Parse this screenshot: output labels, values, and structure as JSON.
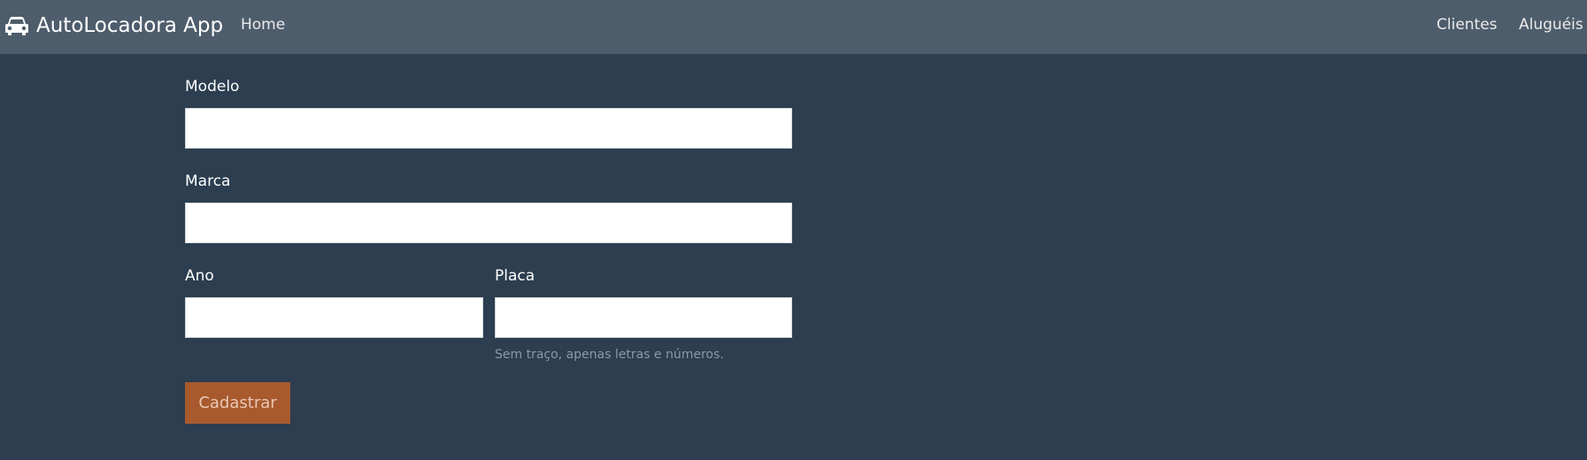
{
  "navbar": {
    "brand": "AutoLocadora App",
    "brand_icon": "car-icon",
    "links": {
      "home": "Home",
      "clientes": "Clientes",
      "alugueis": "Aluguéis"
    }
  },
  "form": {
    "modelo": {
      "label": "Modelo",
      "value": ""
    },
    "marca": {
      "label": "Marca",
      "value": ""
    },
    "ano": {
      "label": "Ano",
      "value": ""
    },
    "placa": {
      "label": "Placa",
      "value": "",
      "help": "Sem traço, apenas letras e números."
    },
    "submit_label": "Cadastrar"
  },
  "colors": {
    "background": "#2c3e50",
    "navbar": "#4e5d6c",
    "button": "#a85a2e"
  }
}
